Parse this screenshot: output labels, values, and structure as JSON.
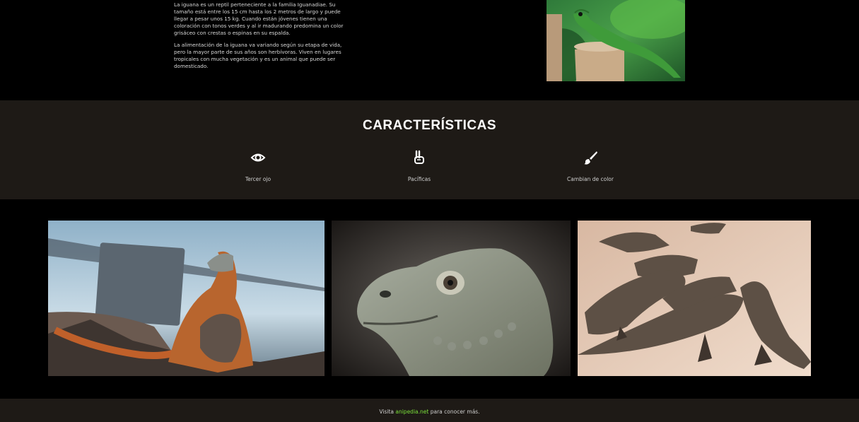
{
  "intro": {
    "paragraph_1": "La iguana es un reptil perteneciente a la familia Iguanadiae. Su tamaño está entre los 15 cm hasta los 2 metros de largo y puede llegar a pesar unos 15 kg. Cuando están jóvenes tienen una coloración con tonos verdes y al ir madurando predomina un color grisáceo con crestas o espinas en su espalda.",
    "paragraph_2": "La alimentación de la iguana va variando según su etapa de vida, pero la mayor parte de sus años son herbívoras. Viven en lugares tropicales con mucha vegetación y es un animal que puede ser domesticado."
  },
  "features": {
    "title": "CARACTERÍSTICAS",
    "items": [
      {
        "label": "Tercer ojo",
        "icon": "eye-icon"
      },
      {
        "label": "Pacíficas",
        "icon": "peace-hand-icon"
      },
      {
        "label": "Cambian de color",
        "icon": "paint-brush-icon"
      }
    ]
  },
  "footer": {
    "prefix": "Visita",
    "link": "anipedia.net",
    "suffix": "para conocer más."
  },
  "colors": {
    "background": "#000000",
    "band": "#1e1a16",
    "link": "#7ae03a"
  }
}
